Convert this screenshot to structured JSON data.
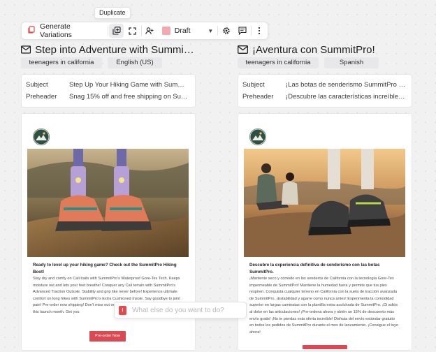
{
  "tooltip": {
    "text": "Duplicate"
  },
  "toolbar": {
    "generate_label": "Generate Variations",
    "status_label": "Draft",
    "status_color": "#f3a9b0"
  },
  "variants": [
    {
      "subject_line": "Step into Adventure with SummitPr...",
      "tags": [
        "teenagers in california",
        "English (US)"
      ],
      "meta": [
        {
          "key": "Subject",
          "value": "Step Up Your Hiking Game with SummitPro ..."
        },
        {
          "key": "Preheader",
          "value": "Snag 15% off and free shipping on Summ..."
        }
      ],
      "body_lead": "Ready to level up your hiking game? Check out the SummitPro Hiking Boot!",
      "body_text": "Stay dry and comfy on Cali trails with SummitPro's Waterproof Gore-Tex Tech. Keeps moisture out and lets your feet breathe! Conquer any Cali terrain with SummitPro's Advanced Traction Outsole. Stability and grip like never before! Experience ultimate comfort on long hikes with SummitPro's Extra Cushioned Insole. Say goodbye to joint pain! Pre-order now shipping! Don't miss out on this awesome deal SummitPro orders this launch month. Get you",
      "cta_label": "Pre-order Now"
    },
    {
      "subject_line": "¡Aventura con SummitPro!",
      "tags": [
        "teenagers in california",
        "Spanish"
      ],
      "meta": [
        {
          "key": "Subject",
          "value": "¡Las botas de senderismo SummitPro están..."
        },
        {
          "key": "Preheader",
          "value": "¡Descubre las características increíbles de l..."
        }
      ],
      "body_lead": "Descubre la experiencia definitiva de senderismo con las botas SummitPro.",
      "body_text": "¡Mantente seco y cómodo en los senderos de California con la tecnología Gore-Tex impermeable de SummitPro! Mantiene la humedad fuera y permite que tus pies respiren. Conquista cualquier terreno en California con la suela de tracción avanzada de SummitPro. ¡Estabilidad y agarre como nunca antes! Experimenta la comodidad superior en largas caminatas con la plantilla extra acolchada de SummitPro. ¡Di adiós al dolor en las articulaciones! ¡Pre-ordena ahora y obtén un 15% de descuento más envío gratis! ¡No te pierdas esta oferta increíble! Disfruta del envío estándar gratuito en todos los pedidos de SummitPro durante el mes de lanzamiento. ¡Consigue el tuyo ahora!",
      "cta_label": ""
    }
  ],
  "prompt": {
    "placeholder": "What else do you want to do?",
    "value": ""
  },
  "colors": {
    "accent": "#e5484d",
    "cta": "#d94a54"
  }
}
